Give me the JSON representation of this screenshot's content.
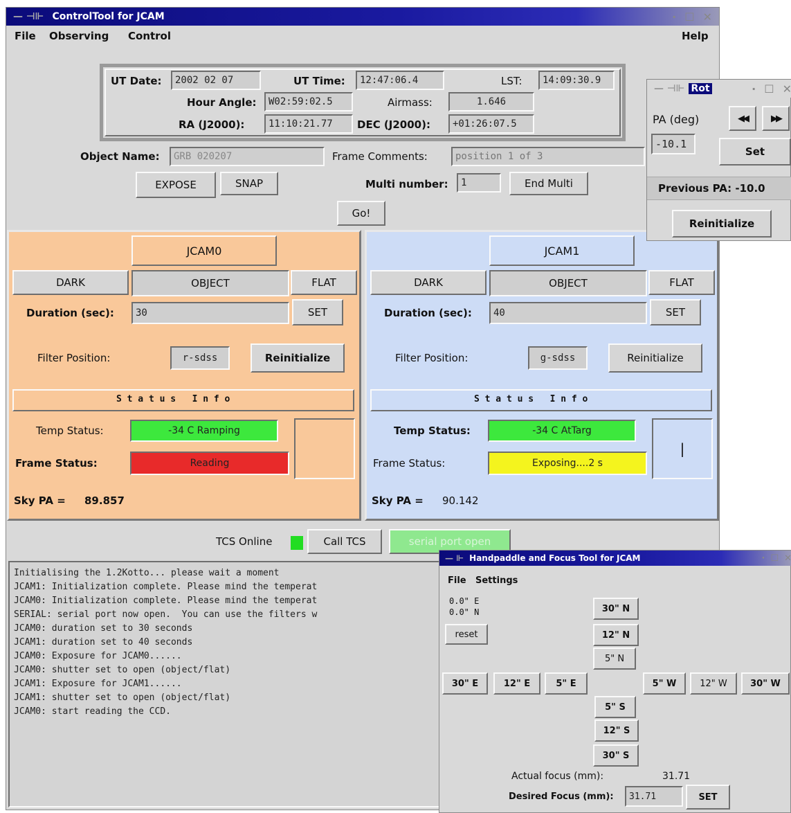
{
  "main_window": {
    "title": "ControlTool for JCAM",
    "title_controls": {
      "minimize": "·",
      "maximize": "☐",
      "close": "✕"
    },
    "menu": {
      "file": "File",
      "observing": "Observing",
      "control": "Control",
      "help": "Help"
    }
  },
  "telescope": {
    "ut_date_label": "UT Date:",
    "ut_date": "2002 02 07",
    "ut_time_label": "UT Time:",
    "ut_time": "12:47:06.4",
    "lst_label": "LST:",
    "lst": "14:09:30.9",
    "hour_angle_label": "Hour Angle:",
    "hour_angle": "W02:59:02.5",
    "airmass_label": "Airmass:",
    "airmass": "1.646",
    "ra_label": "RA (J2000):",
    "ra": "11:10:21.77",
    "dec_label": "DEC (J2000):",
    "dec": "+01:26:07.5"
  },
  "observation": {
    "object_name_label": "Object Name:",
    "object_name": "GRB 020207",
    "frame_comments_label": "Frame Comments:",
    "frame_comments": "position 1 of 3",
    "expose_button": "EXPOSE",
    "snap_button": "SNAP",
    "multi_number_label": "Multi number:",
    "multi_number": "1",
    "end_multi_button": "End Multi",
    "go_button": "Go!"
  },
  "cameras": [
    {
      "title": "JCAM0",
      "bg": "#f9c89a",
      "dark": "DARK",
      "object": "OBJECT",
      "flat": "FLAT",
      "duration_label": "Duration (sec):",
      "duration": "30",
      "set": "SET",
      "filter_label": "Filter Position:",
      "filter": "r-sdss",
      "reinit": "Reinitialize",
      "status_header": "S t a t u s   I n f o",
      "temp_label": "Temp Status:",
      "temp_status": "-34 C Ramping",
      "temp_color": "#3de83d",
      "frame_label": "Frame Status:",
      "frame_status": "Reading",
      "frame_color": "#e82a2a",
      "box_text": "",
      "sky_pa_label": "Sky PA =",
      "sky_pa": "89.857"
    },
    {
      "title": "JCAM1",
      "bg": "#cddcf6",
      "dark": "DARK",
      "object": "OBJECT",
      "flat": "FLAT",
      "duration_label": "Duration (sec):",
      "duration": "40",
      "set": "SET",
      "filter_label": "Filter Position:",
      "filter": "g-sdss",
      "reinit": "Reinitialize",
      "status_header": "S t a t u s   I n f o",
      "temp_label": "Temp Status:",
      "temp_status": "-34 C AtTarg",
      "temp_color": "#3de83d",
      "frame_label": "Frame Status:",
      "frame_status": "Exposing....2 s",
      "frame_color": "#f4f41e",
      "box_text": "|",
      "sky_pa_label": "Sky PA =",
      "sky_pa": "90.142"
    }
  ],
  "tcs": {
    "online_label": "TCS Online",
    "online_color": "#22dd22",
    "call_tcs": "Call TCS",
    "serial": "serial port open",
    "serial_color": "#8fe88f"
  },
  "log": {
    "lines": [
      "Initialising the 1.2Kotto... please wait a moment",
      "JCAM1: Initialization complete. Please mind the temperat",
      "JCAM0: Initialization complete. Please mind the temperat",
      "SERIAL: serial port now open.  You can use the filters w",
      "JCAM0: duration set to 30 seconds",
      "JCAM1: duration set to 40 seconds",
      "JCAM0: Exposure for JCAM0......",
      "JCAM0: shutter set to open (object/flat)",
      "JCAM1: Exposure for JCAM1......",
      "JCAM1: shutter set to open (object/flat)",
      "JCAM0: start reading the CCD."
    ]
  },
  "rot_window": {
    "title": "Rot",
    "pa_label": "PA (deg)",
    "rewind": "◀◀",
    "forward": "▶▶",
    "pa_value": "-10.1",
    "set": "Set",
    "previous_pa": "Previous PA: -10.0",
    "reinit": "Reinitialize"
  },
  "focus_window": {
    "title": "Handpaddle and Focus Tool for JCAM",
    "menu_file": "File",
    "menu_settings": "Settings",
    "offset_e": "0.0\" E",
    "offset_n": "0.0\" N",
    "reset": "reset",
    "n30": "30\" N",
    "n12": "12\" N",
    "n5": "5\" N",
    "e30": "30\" E",
    "e12": "12\" E",
    "e5": "5\" E",
    "w5": "5\" W",
    "w12": "12\" W",
    "w30": "30\" W",
    "s5": "5\" S",
    "s12": "12\" S",
    "s30": "30\" S",
    "actual_label": "Actual focus (mm):",
    "actual": "31.71",
    "desired_label": "Desired Focus (mm):",
    "desired": "31.71",
    "set": "SET"
  }
}
